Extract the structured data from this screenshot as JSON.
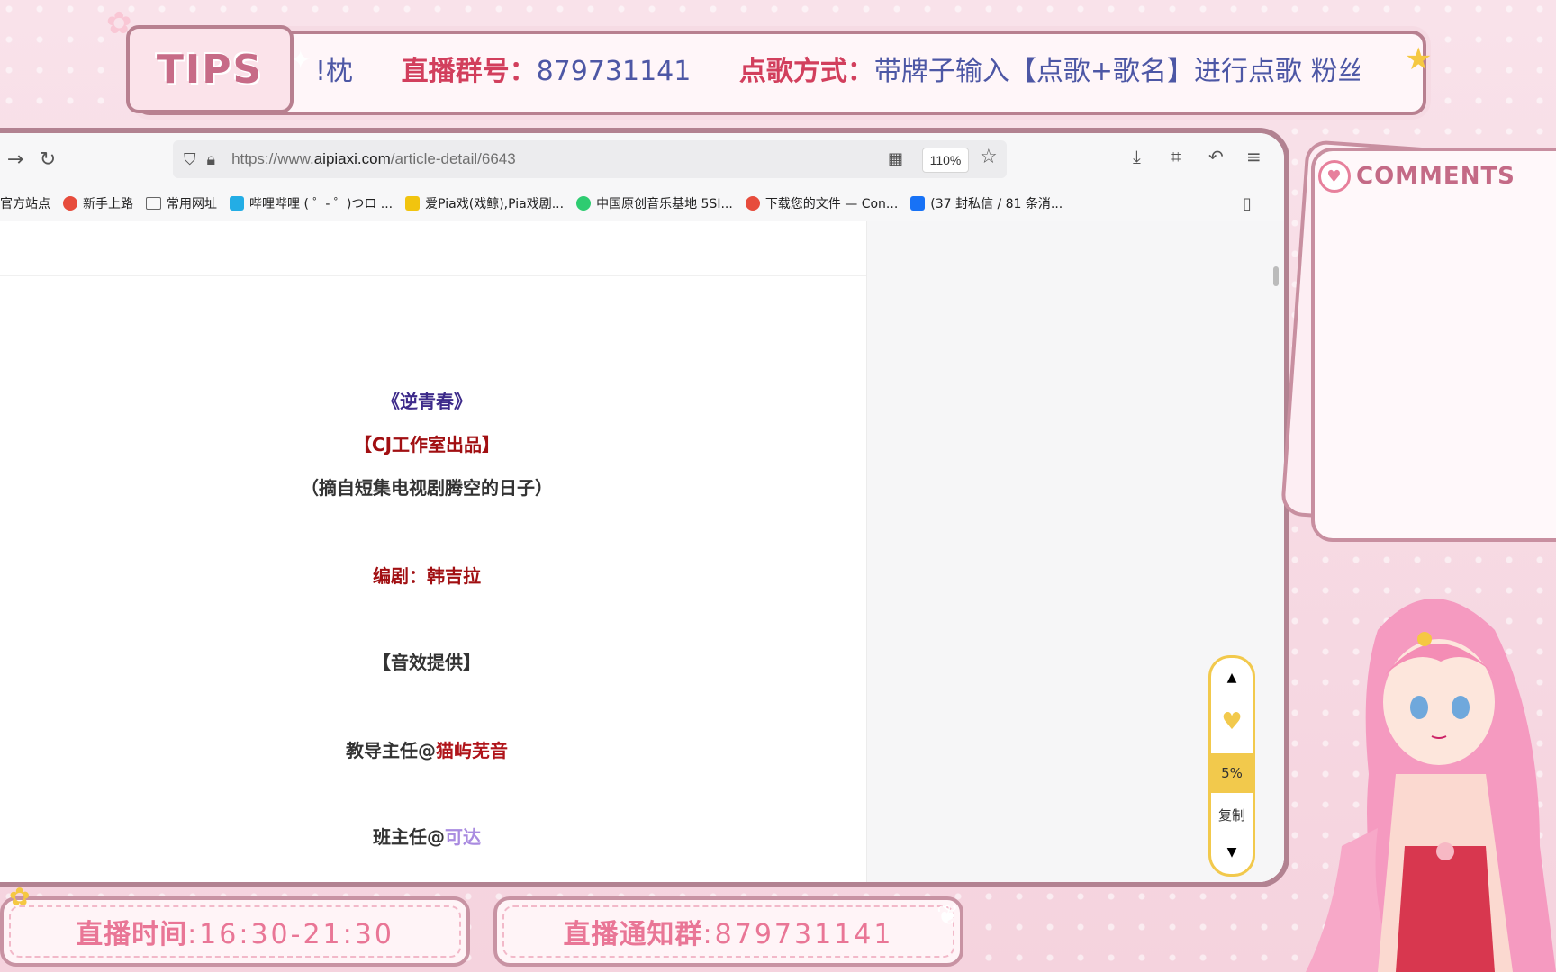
{
  "overlay": {
    "tips_label": "TIPS",
    "marquee": {
      "frag_left": "!枕",
      "group_label": "直播群号：",
      "group_value": "879731141",
      "song_label": "点歌方式：",
      "song_value": "带牌子输入【点歌+歌名】进行点歌 粉丝团钅"
    },
    "comments_title": "COMMENTS",
    "live_time_label": "直播时间",
    "live_time_value": ":16:30-21:30",
    "notice_label": "直播通知群",
    "notice_value": ":879731141"
  },
  "browser": {
    "url_prefix": "https://www.",
    "url_domain": "aipiaxi.com",
    "url_path": "/article-detail/6643",
    "zoom": "110%",
    "bookmarks": [
      {
        "label": "狐官方站点",
        "color": "#ff9f43"
      },
      {
        "label": "新手上路",
        "color": "#e74c3c"
      },
      {
        "label": "常用网址",
        "color": "folder"
      },
      {
        "label": "哔哩哔哩 ( ゜- ゜)つロ ...",
        "color": "#23ade5"
      },
      {
        "label": "爱Pia戏(戏鲸),Pia戏剧...",
        "color": "#f1c40f"
      },
      {
        "label": "中国原创音乐基地 5SI...",
        "color": "#2ecc71"
      },
      {
        "label": "下载您的文件 — Con...",
        "color": "#e74c3c"
      },
      {
        "label": "(37 封私信 / 81 条消...",
        "color": "#1772f6"
      }
    ]
  },
  "article": {
    "title": "《逆青春》",
    "studio": "【CJ工作室出品】",
    "excerpt": "（摘自短集电视剧腾空的日子）",
    "writer_label": "编剧：",
    "writer_name": "韩吉拉",
    "sfx": "【音效提供】",
    "role1_label": "教导主任@",
    "role1_name": "猫屿芜音",
    "role2_label": "班主任@",
    "role2_name": "可达"
  },
  "tools": {
    "percent": "5%",
    "copy": "复制"
  }
}
